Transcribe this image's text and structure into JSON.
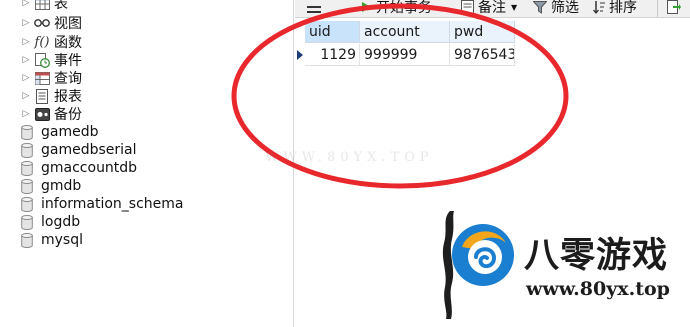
{
  "tree": {
    "nodes": [
      {
        "label": "表",
        "icon": "table-icon"
      },
      {
        "label": "视图",
        "icon": "view-icon"
      },
      {
        "label": "函数",
        "icon": "function-icon"
      },
      {
        "label": "事件",
        "icon": "event-clock-icon"
      },
      {
        "label": "查询",
        "icon": "query-icon"
      },
      {
        "label": "报表",
        "icon": "report-icon"
      },
      {
        "label": "备份",
        "icon": "backup-icon"
      }
    ],
    "databases": [
      "gamedb",
      "gamedbserial",
      "gmaccountdb",
      "gmdb",
      "information_schema",
      "logdb",
      "mysql"
    ]
  },
  "toolbar": {
    "begin_transaction_label": "开始事务",
    "memo_label": "备注",
    "filter_label": "筛选",
    "sort_label": "排序"
  },
  "grid": {
    "columns": [
      "uid",
      "account",
      "pwd"
    ],
    "rows": [
      {
        "uid": "1129",
        "account": "999999",
        "pwd": "9876543"
      }
    ]
  },
  "overlay": {
    "ellipse_color": "#e8282d",
    "watermark_text": "WWW.80YX.TOP"
  },
  "logo": {
    "name": "八零游戏",
    "url": "www.80yx.top"
  }
}
